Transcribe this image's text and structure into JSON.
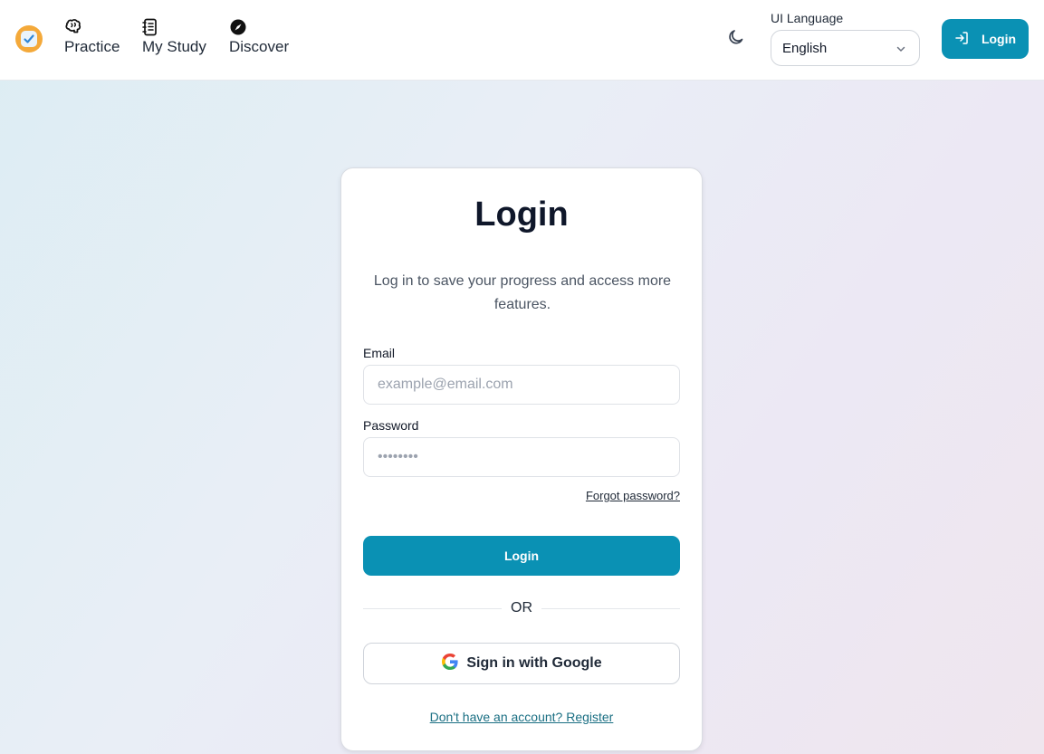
{
  "header": {
    "logo_icon": "checkmark-badge-icon",
    "nav": [
      {
        "label": "Practice",
        "icon": "brain-icon"
      },
      {
        "label": "My Study",
        "icon": "notebook-icon"
      },
      {
        "label": "Discover",
        "icon": "compass-icon"
      }
    ],
    "theme_icon": "moon-icon",
    "language": {
      "label": "UI Language",
      "selected": "English"
    },
    "login_label": "Login",
    "login_icon": "sign-in-icon"
  },
  "card": {
    "title": "Login",
    "subtitle": "Log in to save your progress and access more features.",
    "email_label": "Email",
    "email_placeholder": "example@email.com",
    "password_label": "Password",
    "password_placeholder": "••••••••",
    "forgot_label": "Forgot password?",
    "login_button": "Login",
    "divider_text": "OR",
    "google_button": "Sign in with Google",
    "register_link": "Don't have an account? Register"
  },
  "colors": {
    "accent": "#0a91b4",
    "logo": "#f4a93a"
  }
}
